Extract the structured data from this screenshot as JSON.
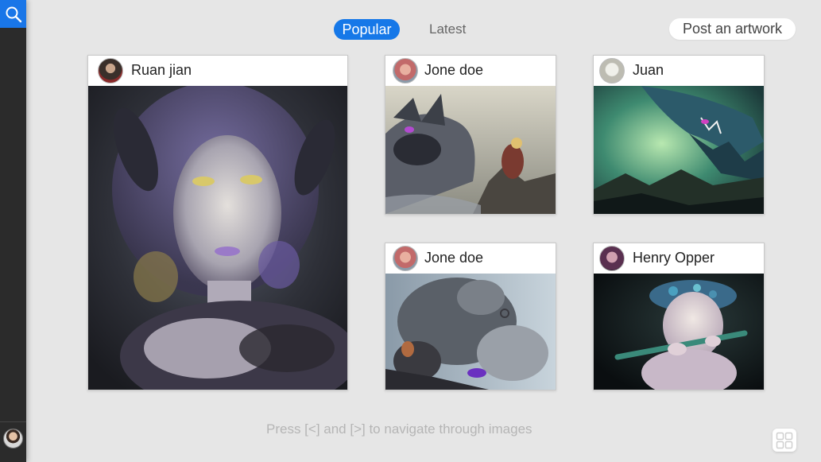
{
  "sidebar": {
    "search_icon": "search-icon",
    "accent_color": "#1976e8"
  },
  "header": {
    "tabs": [
      {
        "label": "Popular",
        "active": true
      },
      {
        "label": "Latest",
        "active": false
      }
    ],
    "post_button_label": "Post an artwork"
  },
  "cards": [
    {
      "user": "Ruan jian"
    },
    {
      "user": "Jone doe"
    },
    {
      "user": "Juan"
    },
    {
      "user": "Jone doe"
    },
    {
      "user": "Henry Opper"
    }
  ],
  "footer": {
    "hint": "Press [<] and [>] to navigate through images",
    "grid_icon": "grid-view-icon"
  }
}
